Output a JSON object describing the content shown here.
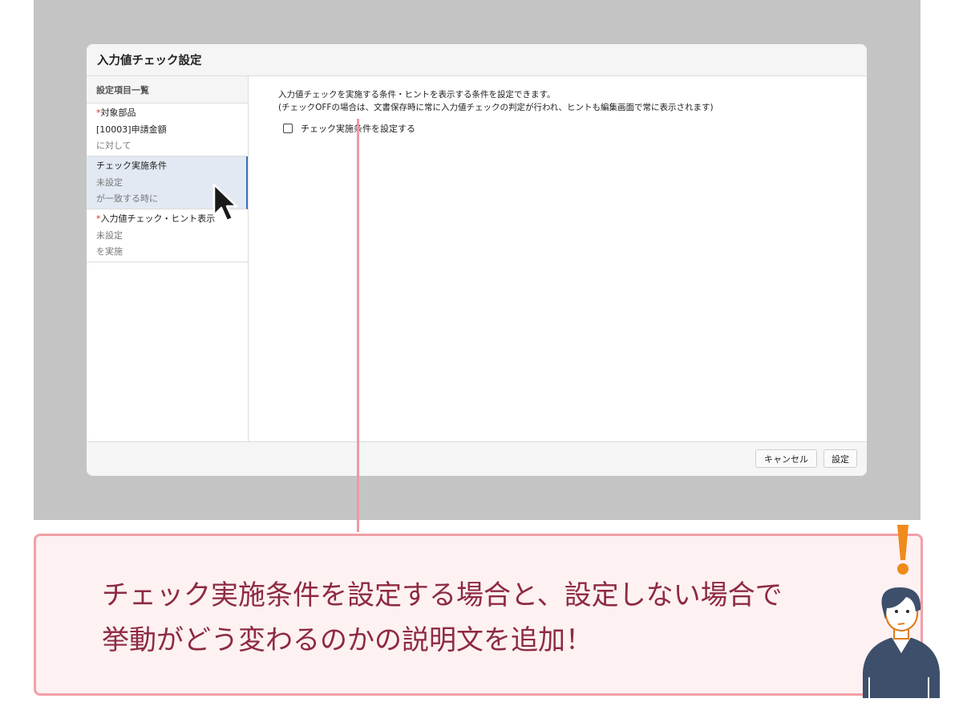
{
  "dialog": {
    "title": "入力値チェック設定",
    "sidebar": {
      "title": "設定項目一覧",
      "items": [
        {
          "required": true,
          "mark": "*",
          "lines": [
            "対象部品",
            "[10003]申請金額",
            "に対して"
          ],
          "selected": false
        },
        {
          "required": false,
          "mark": "",
          "lines": [
            "チェック実施条件",
            "未設定",
            "が一致する時に"
          ],
          "selected": true
        },
        {
          "required": true,
          "mark": "*",
          "lines": [
            "入力値チェック・ヒント表示",
            "未設定",
            "を実施"
          ],
          "selected": false
        }
      ]
    },
    "main": {
      "description_line1": "入力値チェックを実施する条件・ヒントを表示する条件を設定できます。",
      "description_line2": "(チェックOFFの場合は、文書保存時に常に入力値チェックの判定が行われ、ヒントも編集画面で常に表示されます)",
      "checkbox_label": "チェック実施条件を設定する",
      "checkbox_checked": false
    },
    "footer": {
      "cancel_label": "キャンセル",
      "ok_label": "設定"
    }
  },
  "callout": {
    "line1": "チェック実施条件を設定する場合と、設定しない場合で",
    "line2": "挙動がどう変わるのかの説明文を追加！"
  },
  "colors": {
    "backdrop": "#c4c4c4",
    "callout_border": "#f2a0a7",
    "callout_bg": "#fdf1f2",
    "callout_text": "#8e2a41",
    "selected_item_bg": "#e3e9f3",
    "required_mark": "#d0312d",
    "exclamation": "#f08a1c",
    "person_shirt": "#3d4f6b"
  },
  "icons": [
    "mouse-pointer-icon",
    "exclamation-icon",
    "person-illustration"
  ]
}
